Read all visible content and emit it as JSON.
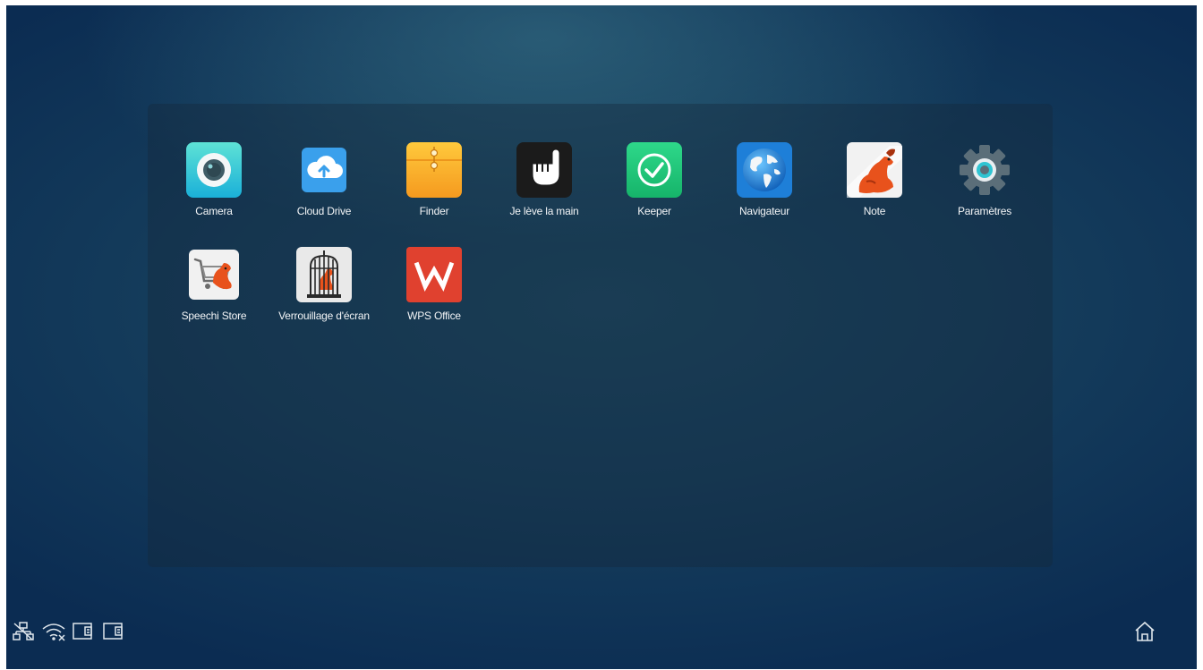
{
  "apps": [
    {
      "name": "Camera",
      "icon": "camera-icon"
    },
    {
      "name": "Cloud Drive",
      "icon": "cloud-drive-icon"
    },
    {
      "name": "Finder",
      "icon": "folder-envelope-icon"
    },
    {
      "name": "Je lève la main",
      "icon": "raised-hand-icon"
    },
    {
      "name": "Keeper",
      "icon": "broom-cleaner-icon"
    },
    {
      "name": "Navigateur",
      "icon": "globe-icon"
    },
    {
      "name": "Note",
      "icon": "dog-note-icon"
    },
    {
      "name": "Paramètres",
      "icon": "gear-icon"
    },
    {
      "name": "Speechi Store",
      "icon": "dog-cart-store-icon"
    },
    {
      "name": "Verrouillage d'écran",
      "icon": "caged-dog-lock-icon"
    },
    {
      "name": "WPS Office",
      "icon": "wps-office-icon"
    }
  ],
  "status_icons": [
    "ethernet-disconnected-icon",
    "wifi-disconnected-icon",
    "device-screen-icon",
    "device-screen-icon"
  ],
  "nav": {
    "home_icon": "home-icon"
  },
  "colors": {
    "background_top": "#2b5a72",
    "background_bottom": "#0b2c52",
    "label_text": "#f2f4f6",
    "status_icon": "#dfe6ec"
  }
}
